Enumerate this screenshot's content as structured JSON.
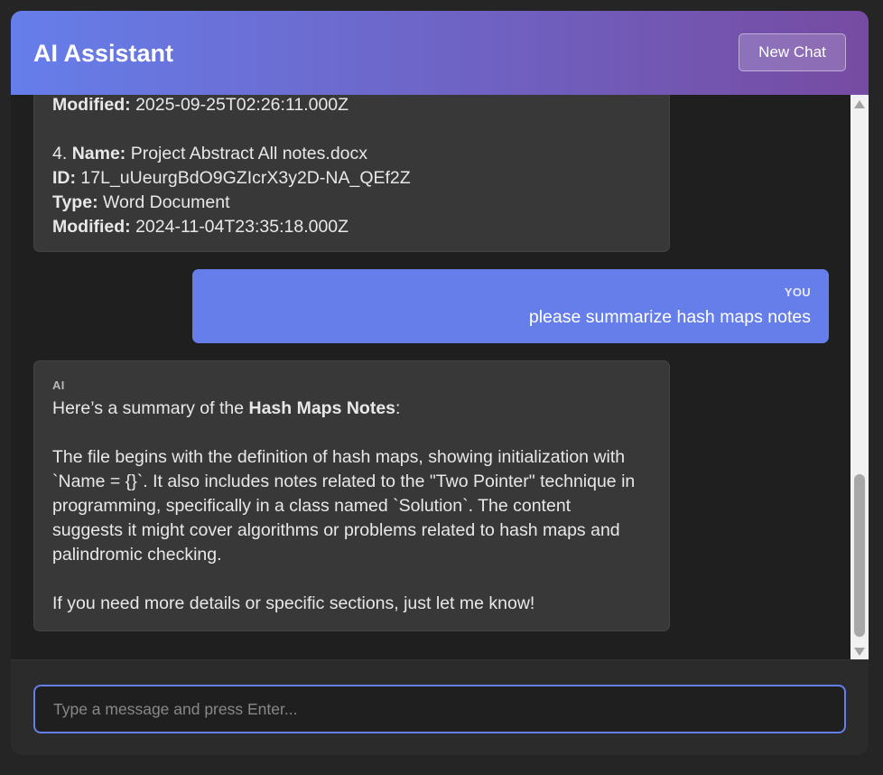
{
  "header": {
    "title": "AI Assistant",
    "new_chat_label": "New Chat"
  },
  "messages": {
    "file_card": {
      "partial_label": "Modified:",
      "partial_value": " 2025-09-25T02:26:11.000Z",
      "item_number": "4. ",
      "name_label": "Name:",
      "name_value": " Project Abstract All notes.docx",
      "id_label": "ID:",
      "id_value": " 17L_uUeurgBdO9GZIcrX3y2D-NA_QEf2Z",
      "type_label": "Type:",
      "type_value": " Word Document",
      "modified_label": "Modified:",
      "modified_value": " 2024-11-04T23:35:18.000Z"
    },
    "user_message": {
      "role": "YOU",
      "text": "please summarize hash maps notes"
    },
    "ai_reply": {
      "role": "AI",
      "intro_prefix": "Here’s a summary of the ",
      "intro_bold": "Hash Maps Notes",
      "intro_suffix": ":",
      "paragraph_lines": [
        "The file begins with the definition of hash maps, showing initialization with",
        "`Name = {}`. It also includes notes related to the \"Two Pointer\" technique in",
        "programming, specifically in a class named `Solution`. The content",
        "suggests it might cover algorithms or problems related to hash maps and",
        "palindromic checking."
      ],
      "closing": "If you need more details or specific sections, just let me know!"
    }
  },
  "input": {
    "placeholder": "Type a message and press Enter...",
    "value": ""
  },
  "colors": {
    "accent": "#667eea",
    "gradient_end": "#764ba2",
    "background": "#1f1f1f",
    "ai_bubble": "#383838"
  }
}
